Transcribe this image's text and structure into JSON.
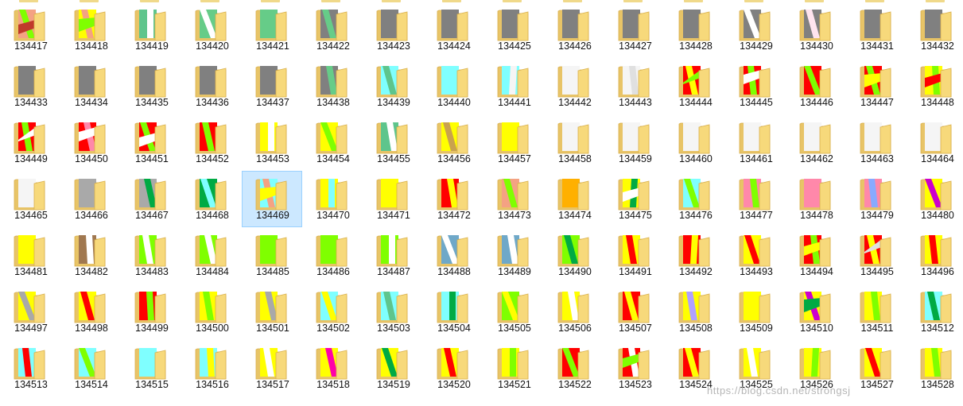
{
  "window": {
    "type": "file-explorer-large-icons"
  },
  "colors": {
    "folder_back": "#e8c467",
    "folder_front": "#f7d97b",
    "folder_edge": "#d9b04d",
    "selection_bg": "#cce8ff",
    "selection_border": "#99d1ff"
  },
  "selected_item": "134469",
  "items": [
    {
      "name": "134417",
      "icon": "folder-icon",
      "colors": [
        "#f4a283",
        "#7fff00",
        "#c0392b"
      ]
    },
    {
      "name": "134418",
      "icon": "folder-icon",
      "colors": [
        "#ffff00",
        "#f4a283",
        "#7fff00"
      ]
    },
    {
      "name": "134419",
      "icon": "folder-icon",
      "colors": [
        "#5ec58c",
        "#ffffff"
      ]
    },
    {
      "name": "134420",
      "icon": "folder-icon",
      "colors": [
        "#66cc88",
        "#ffffff"
      ]
    },
    {
      "name": "134421",
      "icon": "folder-icon",
      "colors": [
        "#66cc88"
      ]
    },
    {
      "name": "134422",
      "icon": "folder-icon",
      "colors": [
        "#808080",
        "#66cc88"
      ]
    },
    {
      "name": "134423",
      "icon": "folder-icon",
      "colors": [
        "#808080"
      ]
    },
    {
      "name": "134424",
      "icon": "folder-icon",
      "colors": [
        "#808080"
      ]
    },
    {
      "name": "134425",
      "icon": "folder-icon",
      "colors": [
        "#808080"
      ]
    },
    {
      "name": "134426",
      "icon": "folder-icon",
      "colors": [
        "#808080"
      ]
    },
    {
      "name": "134427",
      "icon": "folder-icon",
      "colors": [
        "#808080"
      ]
    },
    {
      "name": "134428",
      "icon": "folder-icon",
      "colors": [
        "#808080"
      ]
    },
    {
      "name": "134429",
      "icon": "folder-icon",
      "colors": [
        "#808080",
        "#ffffff"
      ]
    },
    {
      "name": "134430",
      "icon": "folder-icon",
      "colors": [
        "#808080",
        "#ffe4ef"
      ]
    },
    {
      "name": "134431",
      "icon": "folder-icon",
      "colors": [
        "#808080"
      ]
    },
    {
      "name": "134432",
      "icon": "folder-icon",
      "colors": [
        "#808080"
      ]
    },
    {
      "name": "134433",
      "icon": "folder-icon",
      "colors": [
        "#808080"
      ]
    },
    {
      "name": "134434",
      "icon": "folder-icon",
      "colors": [
        "#808080"
      ]
    },
    {
      "name": "134435",
      "icon": "folder-icon",
      "colors": [
        "#808080"
      ]
    },
    {
      "name": "134436",
      "icon": "folder-icon",
      "colors": [
        "#808080"
      ]
    },
    {
      "name": "134437",
      "icon": "folder-icon",
      "colors": [
        "#808080"
      ]
    },
    {
      "name": "134438",
      "icon": "folder-icon",
      "colors": [
        "#808080",
        "#66cc88"
      ]
    },
    {
      "name": "134439",
      "icon": "folder-icon",
      "colors": [
        "#7fffff",
        "#5ec58c"
      ]
    },
    {
      "name": "134440",
      "icon": "folder-icon",
      "colors": [
        "#7fffff"
      ]
    },
    {
      "name": "134441",
      "icon": "folder-icon",
      "colors": [
        "#7fffff",
        "#f5f5f5"
      ]
    },
    {
      "name": "134442",
      "icon": "folder-icon",
      "colors": [
        "#f5f5f5"
      ]
    },
    {
      "name": "134443",
      "icon": "folder-icon",
      "colors": [
        "#f5f5f5",
        "#e0e0e0"
      ]
    },
    {
      "name": "134444",
      "icon": "folder-icon",
      "colors": [
        "#ff0000",
        "#ffff00",
        "#7fff00"
      ]
    },
    {
      "name": "134445",
      "icon": "folder-icon",
      "colors": [
        "#ff0000",
        "#7fff00",
        "#ffffff"
      ]
    },
    {
      "name": "134446",
      "icon": "folder-icon",
      "colors": [
        "#ff0000",
        "#7fff00"
      ]
    },
    {
      "name": "134447",
      "icon": "folder-icon",
      "colors": [
        "#ff0000",
        "#7fff00",
        "#ffff00"
      ]
    },
    {
      "name": "134448",
      "icon": "folder-icon",
      "colors": [
        "#ffff00",
        "#7fff00",
        "#ff0000"
      ]
    },
    {
      "name": "134449",
      "icon": "folder-icon",
      "colors": [
        "#ff0000",
        "#7fff00",
        "#ffffff"
      ]
    },
    {
      "name": "134450",
      "icon": "folder-icon",
      "colors": [
        "#ff0000",
        "#ff88aa",
        "#ffffff"
      ]
    },
    {
      "name": "134451",
      "icon": "folder-icon",
      "colors": [
        "#ff0000",
        "#7fff00",
        "#ffffff"
      ]
    },
    {
      "name": "134452",
      "icon": "folder-icon",
      "colors": [
        "#ff0000",
        "#7fff00"
      ]
    },
    {
      "name": "134453",
      "icon": "folder-icon",
      "colors": [
        "#ffff00",
        "#ffffff"
      ]
    },
    {
      "name": "134454",
      "icon": "folder-icon",
      "colors": [
        "#ffff00",
        "#7fff00"
      ]
    },
    {
      "name": "134455",
      "icon": "folder-icon",
      "colors": [
        "#5ec58c",
        "#ffffff"
      ]
    },
    {
      "name": "134456",
      "icon": "folder-icon",
      "colors": [
        "#ffff00",
        "#c9a24e"
      ]
    },
    {
      "name": "134457",
      "icon": "folder-icon",
      "colors": [
        "#ffff00"
      ]
    },
    {
      "name": "134458",
      "icon": "folder-icon",
      "colors": [
        "#f5f5f5"
      ]
    },
    {
      "name": "134459",
      "icon": "folder-icon",
      "colors": [
        "#f5f5f5"
      ]
    },
    {
      "name": "134460",
      "icon": "folder-icon",
      "colors": [
        "#f5f5f5"
      ]
    },
    {
      "name": "134461",
      "icon": "folder-icon",
      "colors": [
        "#f5f5f5"
      ]
    },
    {
      "name": "134462",
      "icon": "folder-icon",
      "colors": [
        "#f5f5f5"
      ]
    },
    {
      "name": "134463",
      "icon": "folder-icon",
      "colors": [
        "#f5f5f5"
      ]
    },
    {
      "name": "134464",
      "icon": "folder-icon",
      "colors": [
        "#f5f5f5"
      ]
    },
    {
      "name": "134465",
      "icon": "folder-icon",
      "colors": [
        "#f5f5f5"
      ]
    },
    {
      "name": "134466",
      "icon": "folder-icon",
      "colors": [
        "#a9a9a9"
      ]
    },
    {
      "name": "134467",
      "icon": "folder-icon",
      "colors": [
        "#a9a9a9",
        "#00aa44"
      ]
    },
    {
      "name": "134468",
      "icon": "folder-icon",
      "colors": [
        "#00aa44",
        "#7fffff"
      ]
    },
    {
      "name": "134469",
      "icon": "folder-icon",
      "colors": [
        "#7fffff",
        "#f4a283",
        "#ffff00"
      ]
    },
    {
      "name": "134470",
      "icon": "folder-icon",
      "colors": [
        "#ffff00",
        "#7fffff"
      ]
    },
    {
      "name": "134471",
      "icon": "folder-icon",
      "colors": [
        "#ffff00"
      ]
    },
    {
      "name": "134472",
      "icon": "folder-icon",
      "colors": [
        "#ff0000",
        "#ffff00"
      ]
    },
    {
      "name": "134473",
      "icon": "folder-icon",
      "colors": [
        "#f4a283",
        "#7fff00"
      ]
    },
    {
      "name": "134474",
      "icon": "folder-icon",
      "colors": [
        "#ffb000"
      ]
    },
    {
      "name": "134475",
      "icon": "folder-icon",
      "colors": [
        "#ffff00",
        "#00aa44",
        "#ffffff"
      ]
    },
    {
      "name": "134476",
      "icon": "folder-icon",
      "colors": [
        "#7fffff",
        "#7fff00"
      ]
    },
    {
      "name": "134477",
      "icon": "folder-icon",
      "colors": [
        "#ff88aa",
        "#7fff00"
      ]
    },
    {
      "name": "134478",
      "icon": "folder-icon",
      "colors": [
        "#ff88aa"
      ]
    },
    {
      "name": "134479",
      "icon": "folder-icon",
      "colors": [
        "#ff88aa",
        "#88aaff"
      ]
    },
    {
      "name": "134480",
      "icon": "folder-icon",
      "colors": [
        "#ffff00",
        "#cc00cc"
      ]
    },
    {
      "name": "134481",
      "icon": "folder-icon",
      "colors": [
        "#ffff00"
      ]
    },
    {
      "name": "134482",
      "icon": "folder-icon",
      "colors": [
        "#a07850",
        "#ffffff"
      ]
    },
    {
      "name": "134483",
      "icon": "folder-icon",
      "colors": [
        "#7fff00",
        "#ffffff"
      ]
    },
    {
      "name": "134484",
      "icon": "folder-icon",
      "colors": [
        "#7fff00",
        "#ffffff"
      ]
    },
    {
      "name": "134485",
      "icon": "folder-icon",
      "colors": [
        "#7fff00"
      ]
    },
    {
      "name": "134486",
      "icon": "folder-icon",
      "colors": [
        "#7fff00"
      ]
    },
    {
      "name": "134487",
      "icon": "folder-icon",
      "colors": [
        "#7fff00",
        "#ffffff"
      ]
    },
    {
      "name": "134488",
      "icon": "folder-icon",
      "colors": [
        "#6fa8c8",
        "#ffffff"
      ]
    },
    {
      "name": "134489",
      "icon": "folder-icon",
      "colors": [
        "#6fa8c8",
        "#ffffff"
      ]
    },
    {
      "name": "134490",
      "icon": "folder-icon",
      "colors": [
        "#7fff00",
        "#00aa44"
      ]
    },
    {
      "name": "134491",
      "icon": "folder-icon",
      "colors": [
        "#ffff00",
        "#ff0000"
      ]
    },
    {
      "name": "134492",
      "icon": "folder-icon",
      "colors": [
        "#ff0000",
        "#ffff00"
      ]
    },
    {
      "name": "134493",
      "icon": "folder-icon",
      "colors": [
        "#ffff00",
        "#ff0000"
      ]
    },
    {
      "name": "134494",
      "icon": "folder-icon",
      "colors": [
        "#ff0000",
        "#7fff00",
        "#ffff00"
      ]
    },
    {
      "name": "134495",
      "icon": "folder-icon",
      "colors": [
        "#ff0000",
        "#ffff00",
        "#e0e0e0"
      ]
    },
    {
      "name": "134496",
      "icon": "folder-icon",
      "colors": [
        "#ffff00",
        "#ff0000"
      ]
    },
    {
      "name": "134497",
      "icon": "folder-icon",
      "colors": [
        "#ffff00",
        "#a9a9a9"
      ]
    },
    {
      "name": "134498",
      "icon": "folder-icon",
      "colors": [
        "#ffff00",
        "#ff0000"
      ]
    },
    {
      "name": "134499",
      "icon": "folder-icon",
      "colors": [
        "#ff0000",
        "#7fff00"
      ]
    },
    {
      "name": "134500",
      "icon": "folder-icon",
      "colors": [
        "#ffff00",
        "#7fff00"
      ]
    },
    {
      "name": "134501",
      "icon": "folder-icon",
      "colors": [
        "#ffff00",
        "#a9a9a9"
      ]
    },
    {
      "name": "134502",
      "icon": "folder-icon",
      "colors": [
        "#7fffff",
        "#ffff00"
      ]
    },
    {
      "name": "134503",
      "icon": "folder-icon",
      "colors": [
        "#7fffff",
        "#5ec58c"
      ]
    },
    {
      "name": "134504",
      "icon": "folder-icon",
      "colors": [
        "#7fffff",
        "#00aa44"
      ]
    },
    {
      "name": "134505",
      "icon": "folder-icon",
      "colors": [
        "#7fff00",
        "#ffff00"
      ]
    },
    {
      "name": "134506",
      "icon": "folder-icon",
      "colors": [
        "#ffff00",
        "#ffffff"
      ]
    },
    {
      "name": "134507",
      "icon": "folder-icon",
      "colors": [
        "#ff0000",
        "#ffff00"
      ]
    },
    {
      "name": "134508",
      "icon": "folder-icon",
      "colors": [
        "#ffff00",
        "#b0a0ff"
      ]
    },
    {
      "name": "134509",
      "icon": "folder-icon",
      "colors": [
        "#ffff00"
      ]
    },
    {
      "name": "134510",
      "icon": "folder-icon",
      "colors": [
        "#ffff00",
        "#cc00cc",
        "#00aa44"
      ]
    },
    {
      "name": "134511",
      "icon": "folder-icon",
      "colors": [
        "#ffff00",
        "#7fff00"
      ]
    },
    {
      "name": "134512",
      "icon": "folder-icon",
      "colors": [
        "#7fffff",
        "#00aa44"
      ]
    },
    {
      "name": "134513",
      "icon": "folder-icon",
      "colors": [
        "#7fffff",
        "#ff0000"
      ]
    },
    {
      "name": "134514",
      "icon": "folder-icon",
      "colors": [
        "#7fffff",
        "#7fff00"
      ]
    },
    {
      "name": "134515",
      "icon": "folder-icon",
      "colors": [
        "#7fffff"
      ]
    },
    {
      "name": "134516",
      "icon": "folder-icon",
      "colors": [
        "#7fffff",
        "#ffff00"
      ]
    },
    {
      "name": "134517",
      "icon": "folder-icon",
      "colors": [
        "#ffff00",
        "#ffffff"
      ]
    },
    {
      "name": "134518",
      "icon": "folder-icon",
      "colors": [
        "#ffff00",
        "#ff00aa"
      ]
    },
    {
      "name": "134519",
      "icon": "folder-icon",
      "colors": [
        "#ffff00",
        "#00aa44"
      ]
    },
    {
      "name": "134520",
      "icon": "folder-icon",
      "colors": [
        "#ffff00",
        "#ff0000"
      ]
    },
    {
      "name": "134521",
      "icon": "folder-icon",
      "colors": [
        "#ffff00",
        "#7fff00"
      ]
    },
    {
      "name": "134522",
      "icon": "folder-icon",
      "colors": [
        "#ff0000",
        "#7fff00"
      ]
    },
    {
      "name": "134523",
      "icon": "folder-icon",
      "colors": [
        "#ff0000",
        "#ffffff",
        "#7fff00"
      ]
    },
    {
      "name": "134524",
      "icon": "folder-icon",
      "colors": [
        "#ff0000",
        "#ffff00"
      ]
    },
    {
      "name": "134525",
      "icon": "folder-icon",
      "colors": [
        "#ffff00",
        "#ffffff"
      ]
    },
    {
      "name": "134526",
      "icon": "folder-icon",
      "colors": [
        "#ffff00",
        "#7fff00"
      ]
    },
    {
      "name": "134527",
      "icon": "folder-icon",
      "colors": [
        "#ffff00",
        "#ff0000"
      ]
    },
    {
      "name": "134528",
      "icon": "folder-icon",
      "colors": [
        "#ffff00",
        "#7fff00"
      ]
    }
  ],
  "watermark": "https://blog.csdn.net/strongsj"
}
